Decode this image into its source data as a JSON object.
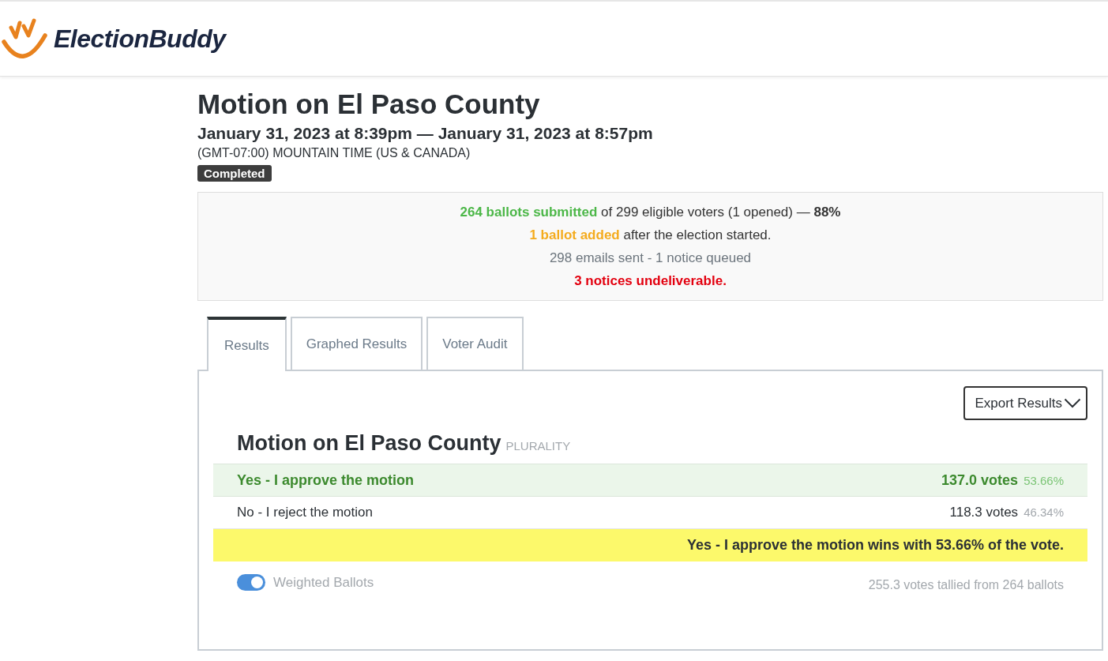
{
  "header": {
    "logo_text": "ElectionBuddy"
  },
  "election": {
    "title": "Motion on El Paso County",
    "period": "January 31, 2023 at 8:39pm — January 31, 2023 at 8:57pm",
    "timezone": "(GMT-07:00) MOUNTAIN TIME (US & CANADA)",
    "status_badge": "Completed"
  },
  "summary": {
    "lines": [
      {
        "kind": "success",
        "highlight": "264 ballots submitted",
        "text": "of 299 eligible voters (1 opened) — **88%**"
      },
      {
        "kind": "warning",
        "highlight": "1 ballot added",
        "text": "after the election started."
      },
      {
        "kind": "muted",
        "text": "298 emails sent - 1 notice queued"
      },
      {
        "kind": "danger",
        "text": "3 notices undeliverable."
      }
    ]
  },
  "tabs": [
    {
      "label": "Results",
      "selected": true
    },
    {
      "label": "Graphed Results",
      "selected": false
    },
    {
      "label": "Voter Audit",
      "selected": false
    }
  ],
  "results": {
    "export_button": "Export Results",
    "question": "Motion on El Paso County",
    "method": "PLURALITY",
    "options": [
      {
        "label": "Yes - I approve the motion",
        "votes": "137.0 votes",
        "percent": "53.66%",
        "winner": true
      },
      {
        "label": "No - I reject the motion",
        "votes": "118.3 votes",
        "percent": "46.34%",
        "winner": false
      }
    ],
    "winner_banner": "Yes - I approve the motion wins with 53.66% of the vote.",
    "weighted_ballots": {
      "label": "Weighted Ballots",
      "on": true
    },
    "tally": "255.3 votes tallied from 264 ballots"
  }
}
